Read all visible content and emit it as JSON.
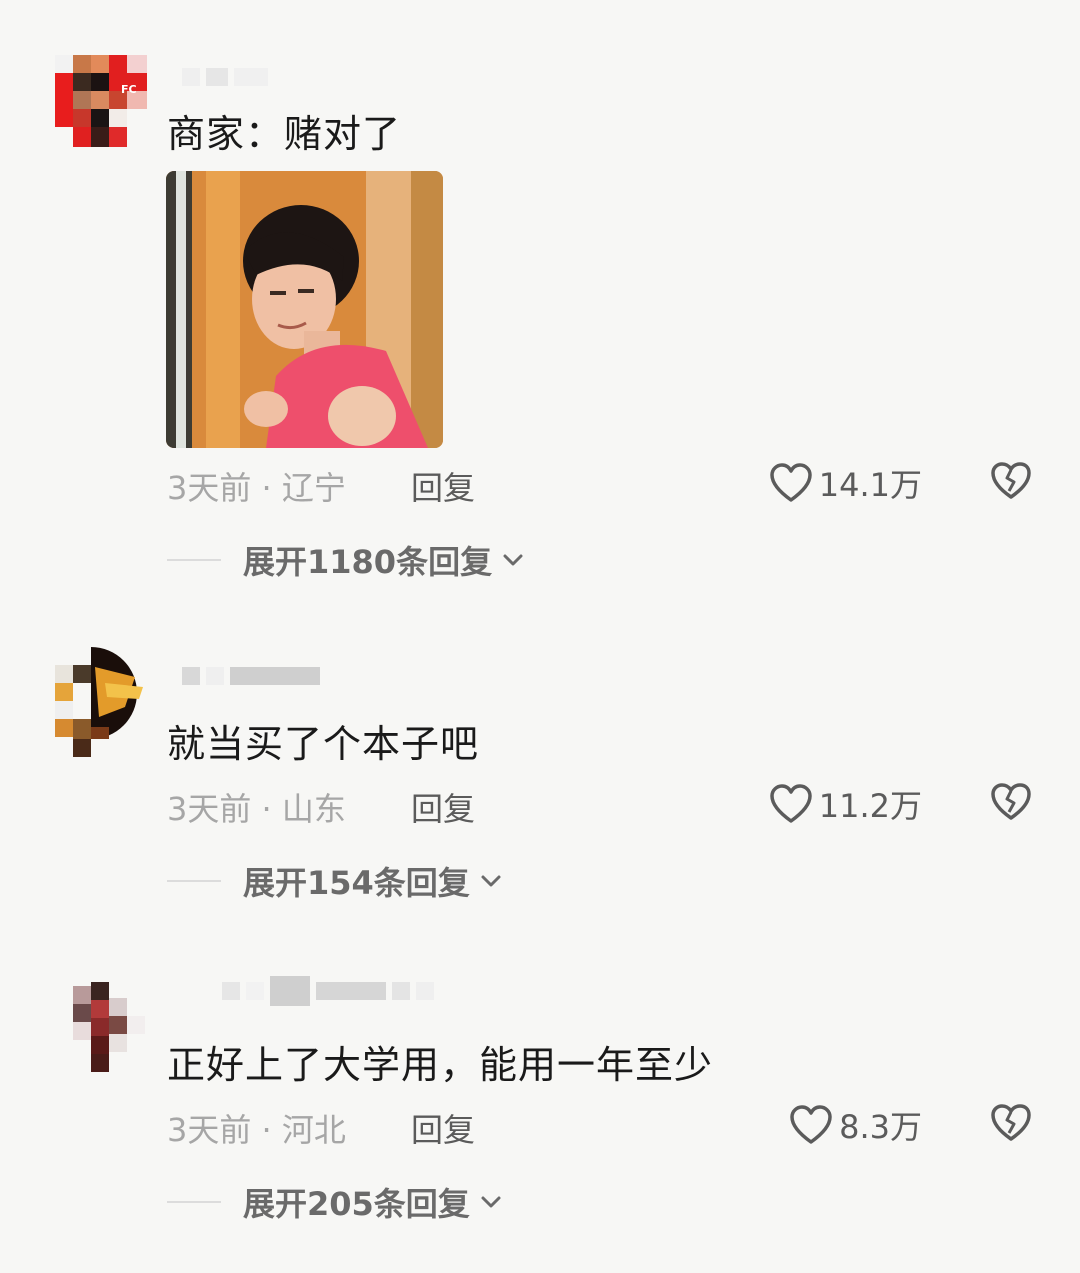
{
  "comments": [
    {
      "text": "商家：赌对了",
      "meta": "3天前 · 辽宁",
      "reply_label": "回复",
      "likes": "14.1万",
      "expand_label": "展开1180条回复",
      "has_sticker": true
    },
    {
      "text": "就当买了个本子吧",
      "meta": "3天前 · 山东",
      "reply_label": "回复",
      "likes": "11.2万",
      "expand_label": "展开154条回复",
      "has_sticker": false
    },
    {
      "text": "正好上了大学用，能用一年至少",
      "meta": "3天前 · 河北",
      "reply_label": "回复",
      "likes": "8.3万",
      "expand_label": "展开205条回复",
      "has_sticker": false
    }
  ],
  "icons": {
    "like": "heart-outline-icon",
    "dislike": "broken-heart-icon",
    "expand": "chevron-down-icon"
  },
  "colors": {
    "background": "#f7f7f5",
    "text": "#1a1a1a",
    "meta": "#a6a6a6",
    "action": "#5b5b5b"
  }
}
